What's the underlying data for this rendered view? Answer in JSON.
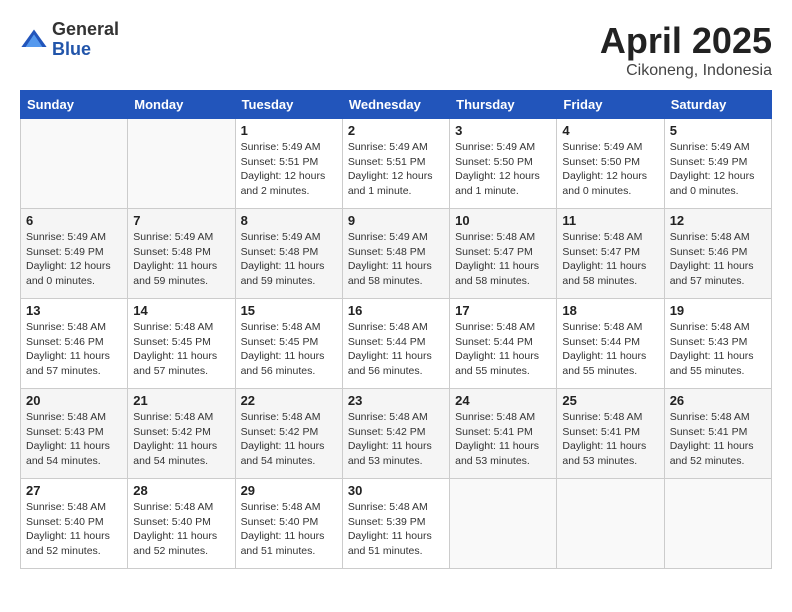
{
  "header": {
    "logo_general": "General",
    "logo_blue": "Blue",
    "month_year": "April 2025",
    "location": "Cikoneng, Indonesia"
  },
  "weekdays": [
    "Sunday",
    "Monday",
    "Tuesday",
    "Wednesday",
    "Thursday",
    "Friday",
    "Saturday"
  ],
  "weeks": [
    [
      {
        "day": "",
        "sunrise": "",
        "sunset": "",
        "daylight": ""
      },
      {
        "day": "",
        "sunrise": "",
        "sunset": "",
        "daylight": ""
      },
      {
        "day": "1",
        "sunrise": "Sunrise: 5:49 AM",
        "sunset": "Sunset: 5:51 PM",
        "daylight": "Daylight: 12 hours and 2 minutes."
      },
      {
        "day": "2",
        "sunrise": "Sunrise: 5:49 AM",
        "sunset": "Sunset: 5:51 PM",
        "daylight": "Daylight: 12 hours and 1 minute."
      },
      {
        "day": "3",
        "sunrise": "Sunrise: 5:49 AM",
        "sunset": "Sunset: 5:50 PM",
        "daylight": "Daylight: 12 hours and 1 minute."
      },
      {
        "day": "4",
        "sunrise": "Sunrise: 5:49 AM",
        "sunset": "Sunset: 5:50 PM",
        "daylight": "Daylight: 12 hours and 0 minutes."
      },
      {
        "day": "5",
        "sunrise": "Sunrise: 5:49 AM",
        "sunset": "Sunset: 5:49 PM",
        "daylight": "Daylight: 12 hours and 0 minutes."
      }
    ],
    [
      {
        "day": "6",
        "sunrise": "Sunrise: 5:49 AM",
        "sunset": "Sunset: 5:49 PM",
        "daylight": "Daylight: 12 hours and 0 minutes."
      },
      {
        "day": "7",
        "sunrise": "Sunrise: 5:49 AM",
        "sunset": "Sunset: 5:48 PM",
        "daylight": "Daylight: 11 hours and 59 minutes."
      },
      {
        "day": "8",
        "sunrise": "Sunrise: 5:49 AM",
        "sunset": "Sunset: 5:48 PM",
        "daylight": "Daylight: 11 hours and 59 minutes."
      },
      {
        "day": "9",
        "sunrise": "Sunrise: 5:49 AM",
        "sunset": "Sunset: 5:48 PM",
        "daylight": "Daylight: 11 hours and 58 minutes."
      },
      {
        "day": "10",
        "sunrise": "Sunrise: 5:48 AM",
        "sunset": "Sunset: 5:47 PM",
        "daylight": "Daylight: 11 hours and 58 minutes."
      },
      {
        "day": "11",
        "sunrise": "Sunrise: 5:48 AM",
        "sunset": "Sunset: 5:47 PM",
        "daylight": "Daylight: 11 hours and 58 minutes."
      },
      {
        "day": "12",
        "sunrise": "Sunrise: 5:48 AM",
        "sunset": "Sunset: 5:46 PM",
        "daylight": "Daylight: 11 hours and 57 minutes."
      }
    ],
    [
      {
        "day": "13",
        "sunrise": "Sunrise: 5:48 AM",
        "sunset": "Sunset: 5:46 PM",
        "daylight": "Daylight: 11 hours and 57 minutes."
      },
      {
        "day": "14",
        "sunrise": "Sunrise: 5:48 AM",
        "sunset": "Sunset: 5:45 PM",
        "daylight": "Daylight: 11 hours and 57 minutes."
      },
      {
        "day": "15",
        "sunrise": "Sunrise: 5:48 AM",
        "sunset": "Sunset: 5:45 PM",
        "daylight": "Daylight: 11 hours and 56 minutes."
      },
      {
        "day": "16",
        "sunrise": "Sunrise: 5:48 AM",
        "sunset": "Sunset: 5:44 PM",
        "daylight": "Daylight: 11 hours and 56 minutes."
      },
      {
        "day": "17",
        "sunrise": "Sunrise: 5:48 AM",
        "sunset": "Sunset: 5:44 PM",
        "daylight": "Daylight: 11 hours and 55 minutes."
      },
      {
        "day": "18",
        "sunrise": "Sunrise: 5:48 AM",
        "sunset": "Sunset: 5:44 PM",
        "daylight": "Daylight: 11 hours and 55 minutes."
      },
      {
        "day": "19",
        "sunrise": "Sunrise: 5:48 AM",
        "sunset": "Sunset: 5:43 PM",
        "daylight": "Daylight: 11 hours and 55 minutes."
      }
    ],
    [
      {
        "day": "20",
        "sunrise": "Sunrise: 5:48 AM",
        "sunset": "Sunset: 5:43 PM",
        "daylight": "Daylight: 11 hours and 54 minutes."
      },
      {
        "day": "21",
        "sunrise": "Sunrise: 5:48 AM",
        "sunset": "Sunset: 5:42 PM",
        "daylight": "Daylight: 11 hours and 54 minutes."
      },
      {
        "day": "22",
        "sunrise": "Sunrise: 5:48 AM",
        "sunset": "Sunset: 5:42 PM",
        "daylight": "Daylight: 11 hours and 54 minutes."
      },
      {
        "day": "23",
        "sunrise": "Sunrise: 5:48 AM",
        "sunset": "Sunset: 5:42 PM",
        "daylight": "Daylight: 11 hours and 53 minutes."
      },
      {
        "day": "24",
        "sunrise": "Sunrise: 5:48 AM",
        "sunset": "Sunset: 5:41 PM",
        "daylight": "Daylight: 11 hours and 53 minutes."
      },
      {
        "day": "25",
        "sunrise": "Sunrise: 5:48 AM",
        "sunset": "Sunset: 5:41 PM",
        "daylight": "Daylight: 11 hours and 53 minutes."
      },
      {
        "day": "26",
        "sunrise": "Sunrise: 5:48 AM",
        "sunset": "Sunset: 5:41 PM",
        "daylight": "Daylight: 11 hours and 52 minutes."
      }
    ],
    [
      {
        "day": "27",
        "sunrise": "Sunrise: 5:48 AM",
        "sunset": "Sunset: 5:40 PM",
        "daylight": "Daylight: 11 hours and 52 minutes."
      },
      {
        "day": "28",
        "sunrise": "Sunrise: 5:48 AM",
        "sunset": "Sunset: 5:40 PM",
        "daylight": "Daylight: 11 hours and 52 minutes."
      },
      {
        "day": "29",
        "sunrise": "Sunrise: 5:48 AM",
        "sunset": "Sunset: 5:40 PM",
        "daylight": "Daylight: 11 hours and 51 minutes."
      },
      {
        "day": "30",
        "sunrise": "Sunrise: 5:48 AM",
        "sunset": "Sunset: 5:39 PM",
        "daylight": "Daylight: 11 hours and 51 minutes."
      },
      {
        "day": "",
        "sunrise": "",
        "sunset": "",
        "daylight": ""
      },
      {
        "day": "",
        "sunrise": "",
        "sunset": "",
        "daylight": ""
      },
      {
        "day": "",
        "sunrise": "",
        "sunset": "",
        "daylight": ""
      }
    ]
  ]
}
